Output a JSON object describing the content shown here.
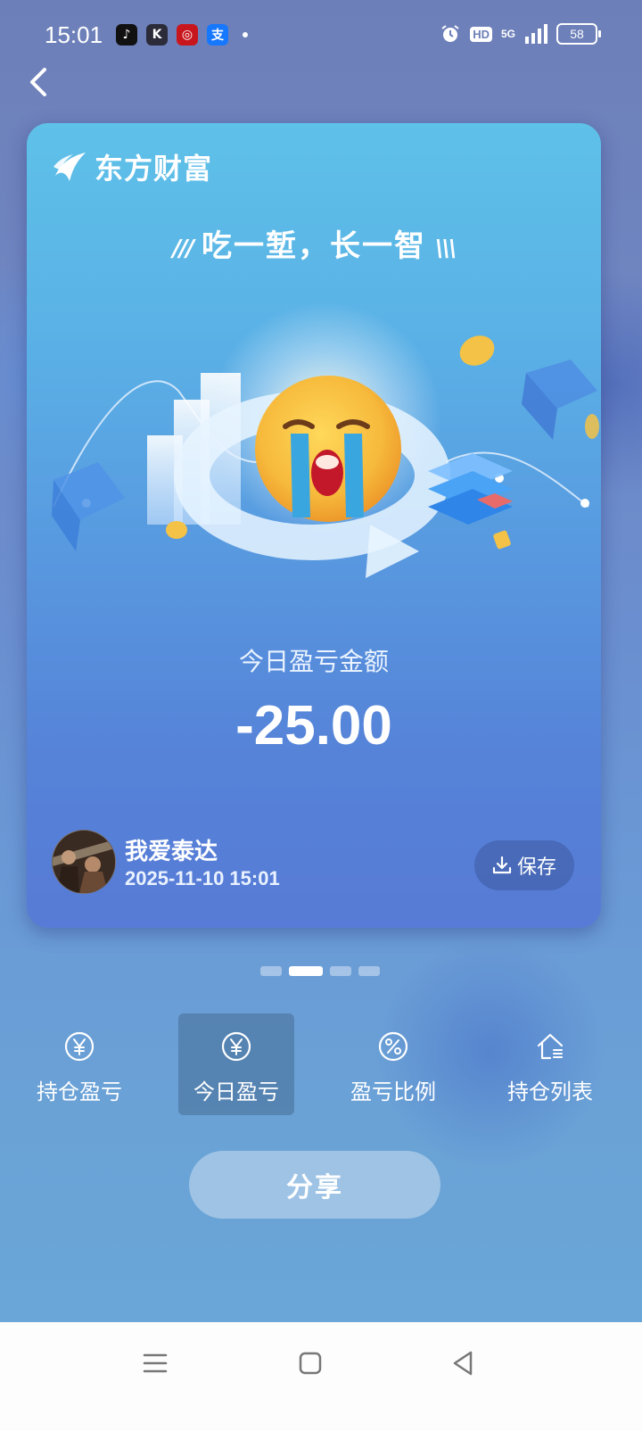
{
  "status_bar": {
    "time": "15:01",
    "apps": [
      {
        "name": "tiktok-icon",
        "glyph": "♪",
        "color": "#111111"
      },
      {
        "name": "k-app-icon",
        "glyph": "K",
        "color": "#2b2b3a"
      },
      {
        "name": "bank-app-icon",
        "glyph": "◎",
        "color": "#c8161d"
      },
      {
        "name": "alipay-icon",
        "glyph": "支",
        "color": "#1677ff"
      }
    ],
    "hd_label": "HD",
    "network_label": "5G",
    "battery": "58"
  },
  "card": {
    "brand": "东方财富",
    "slogan": "吃一堑，长一智",
    "pl_label": "今日盈亏金额",
    "pl_value": "-25.00",
    "username": "我爱泰达",
    "datetime": "2025-11-10 15:01",
    "save_label": "保存"
  },
  "pager": {
    "count": 4,
    "active_index": 1
  },
  "tabs": [
    {
      "label": "持仓盈亏",
      "icon": "yen-circle-icon",
      "active": false
    },
    {
      "label": "今日盈亏",
      "icon": "yen-circle-icon",
      "active": true
    },
    {
      "label": "盈亏比例",
      "icon": "percent-circle-icon",
      "active": false
    },
    {
      "label": "持仓列表",
      "icon": "house-list-icon",
      "active": false
    }
  ],
  "share_label": "分享",
  "colors": {
    "card_top": "#5ec1e8",
    "card_bottom": "#577bd6",
    "emoji": "#f6b93b",
    "tears": "#3aa6e0"
  }
}
